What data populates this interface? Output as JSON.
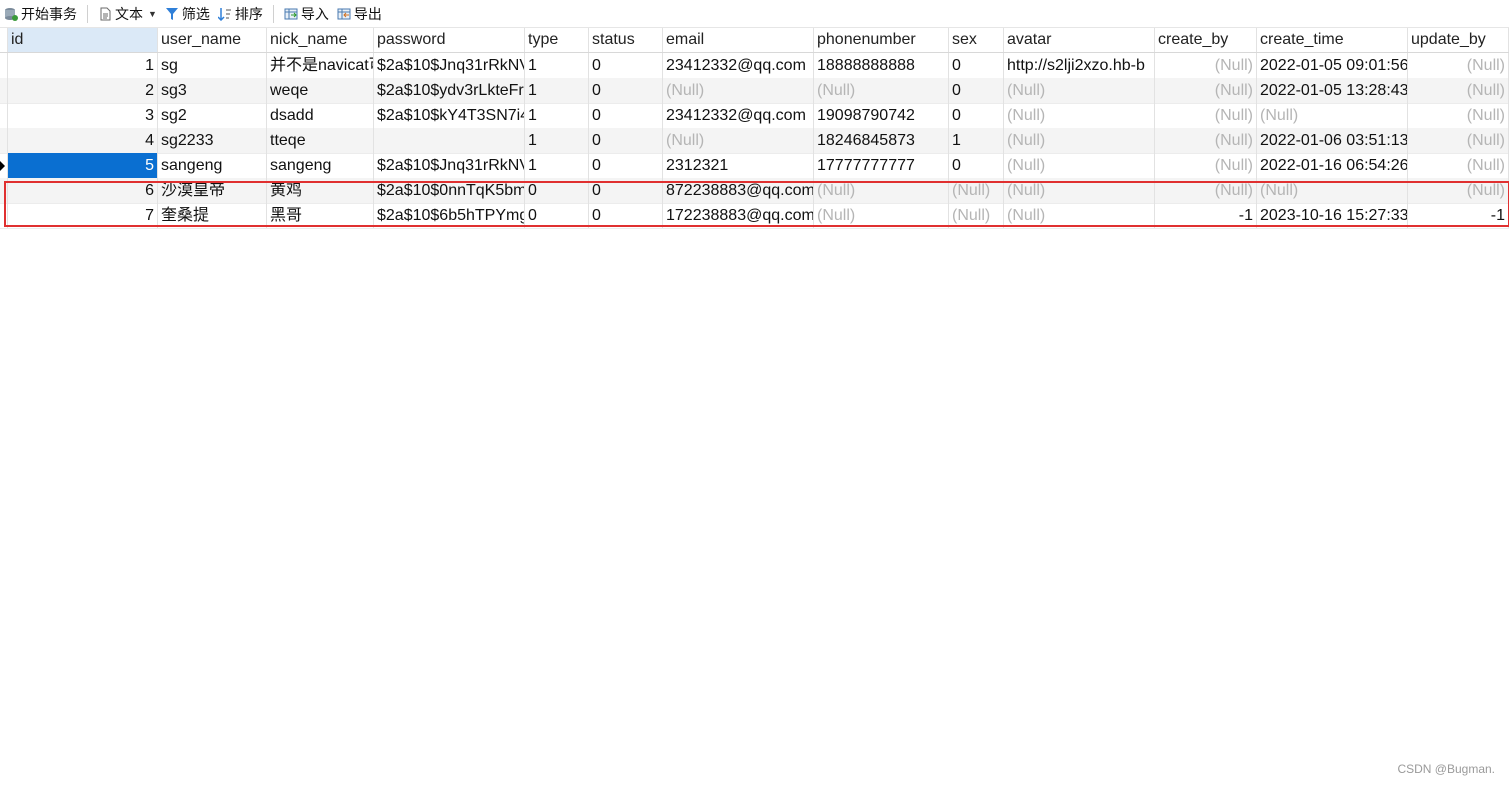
{
  "toolbar": {
    "begin_transaction": "开始事务",
    "text": "文本",
    "filter": "筛选",
    "sort": "排序",
    "import": "导入",
    "export": "导出"
  },
  "columns": [
    "id",
    "user_name",
    "nick_name",
    "password",
    "type",
    "status",
    "email",
    "phonenumber",
    "sex",
    "avatar",
    "create_by",
    "create_time",
    "update_by"
  ],
  "rows": [
    {
      "id": "1",
      "user_name": "sg",
      "nick_name": "并不是navicat可",
      "password": "$2a$10$Jnq31rRkNV",
      "type": "1",
      "status": "0",
      "email": "23412332@qq.com",
      "phonenumber": "18888888888",
      "sex": "0",
      "avatar": "http://s2lji2xzo.hb-b",
      "create_by": "(Null)",
      "create_time": "2022-01-05 09:01:56",
      "update_by": "(Null)"
    },
    {
      "id": "2",
      "user_name": "sg3",
      "nick_name": "weqe",
      "password": "$2a$10$ydv3rLkteFr",
      "type": "1",
      "status": "0",
      "email": "(Null)",
      "phonenumber": "(Null)",
      "sex": "0",
      "avatar": "(Null)",
      "create_by": "(Null)",
      "create_time": "2022-01-05 13:28:43",
      "update_by": "(Null)"
    },
    {
      "id": "3",
      "user_name": "sg2",
      "nick_name": "dsadd",
      "password": "$2a$10$kY4T3SN7i4",
      "type": "1",
      "status": "0",
      "email": "23412332@qq.com",
      "phonenumber": "19098790742",
      "sex": "0",
      "avatar": "(Null)",
      "create_by": "(Null)",
      "create_time": "(Null)",
      "update_by": "(Null)"
    },
    {
      "id": "4",
      "user_name": "sg2233",
      "nick_name": "tteqe",
      "password": "",
      "type": "1",
      "status": "0",
      "email": "(Null)",
      "phonenumber": "18246845873",
      "sex": "1",
      "avatar": "(Null)",
      "create_by": "(Null)",
      "create_time": "2022-01-06 03:51:13",
      "update_by": "(Null)"
    },
    {
      "id": "5",
      "user_name": "sangeng",
      "nick_name": "sangeng",
      "password": "$2a$10$Jnq31rRkNV",
      "type": "1",
      "status": "0",
      "email": "2312321",
      "phonenumber": "17777777777",
      "sex": "0",
      "avatar": "(Null)",
      "create_by": "(Null)",
      "create_time": "2022-01-16 06:54:26",
      "update_by": "(Null)"
    },
    {
      "id": "6",
      "user_name": "沙漠皇帝",
      "nick_name": "黄鸡",
      "password": "$2a$10$0nnTqK5bm",
      "type": "0",
      "status": "0",
      "email": "872238883@qq.com",
      "phonenumber": "(Null)",
      "sex": "(Null)",
      "avatar": "(Null)",
      "create_by": "(Null)",
      "create_time": "(Null)",
      "update_by": "(Null)"
    },
    {
      "id": "7",
      "user_name": "奎桑提",
      "nick_name": "黑哥",
      "password": "$2a$10$6b5hTPYmg",
      "type": "0",
      "status": "0",
      "email": "172238883@qq.com",
      "phonenumber": "(Null)",
      "sex": "(Null)",
      "avatar": "(Null)",
      "create_by": "-1",
      "create_time": "2023-10-16 15:27:33",
      "update_by": "-1"
    }
  ],
  "selected_row": "5",
  "watermark": "CSDN @Bugman."
}
